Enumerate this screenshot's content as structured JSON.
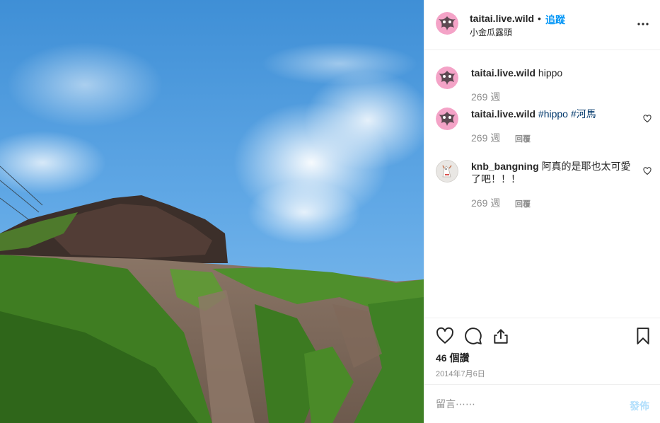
{
  "post": {
    "photo_alt": "",
    "header": {
      "username": "taitai.live.wild",
      "separator": "•",
      "follow_label": "追蹤",
      "location": "小金瓜露頭",
      "more_icon": "more-horizontal-icon"
    },
    "comments": [
      {
        "author": "taitai.live.wild",
        "body": "hippo",
        "tags": [],
        "age": "269 週",
        "reply_label": "",
        "show_like": false
      },
      {
        "author": "taitai.live.wild",
        "body": "",
        "tags": [
          "#hippo",
          "#河馬"
        ],
        "age": "269 週",
        "reply_label": "回覆",
        "show_like": true
      },
      {
        "author": "knb_bangning",
        "body": "阿真的是耶也太可愛了吧！！！",
        "tags": [],
        "age": "269 週",
        "reply_label": "回覆",
        "show_like": true
      }
    ],
    "actions": {
      "like_icon": "heart-icon",
      "comment_icon": "comment-bubble-icon",
      "share_icon": "share-icon",
      "save_icon": "bookmark-icon"
    },
    "likes": "46 個讚",
    "date": "2014年7月6日",
    "add_comment": {
      "placeholder": "留言⋯⋯",
      "post_label": "發佈"
    }
  },
  "colors": {
    "link": "#0095f6",
    "hashtag": "#00376b",
    "muted": "#8e8e8e",
    "post_disabled": "#b2dffc"
  }
}
